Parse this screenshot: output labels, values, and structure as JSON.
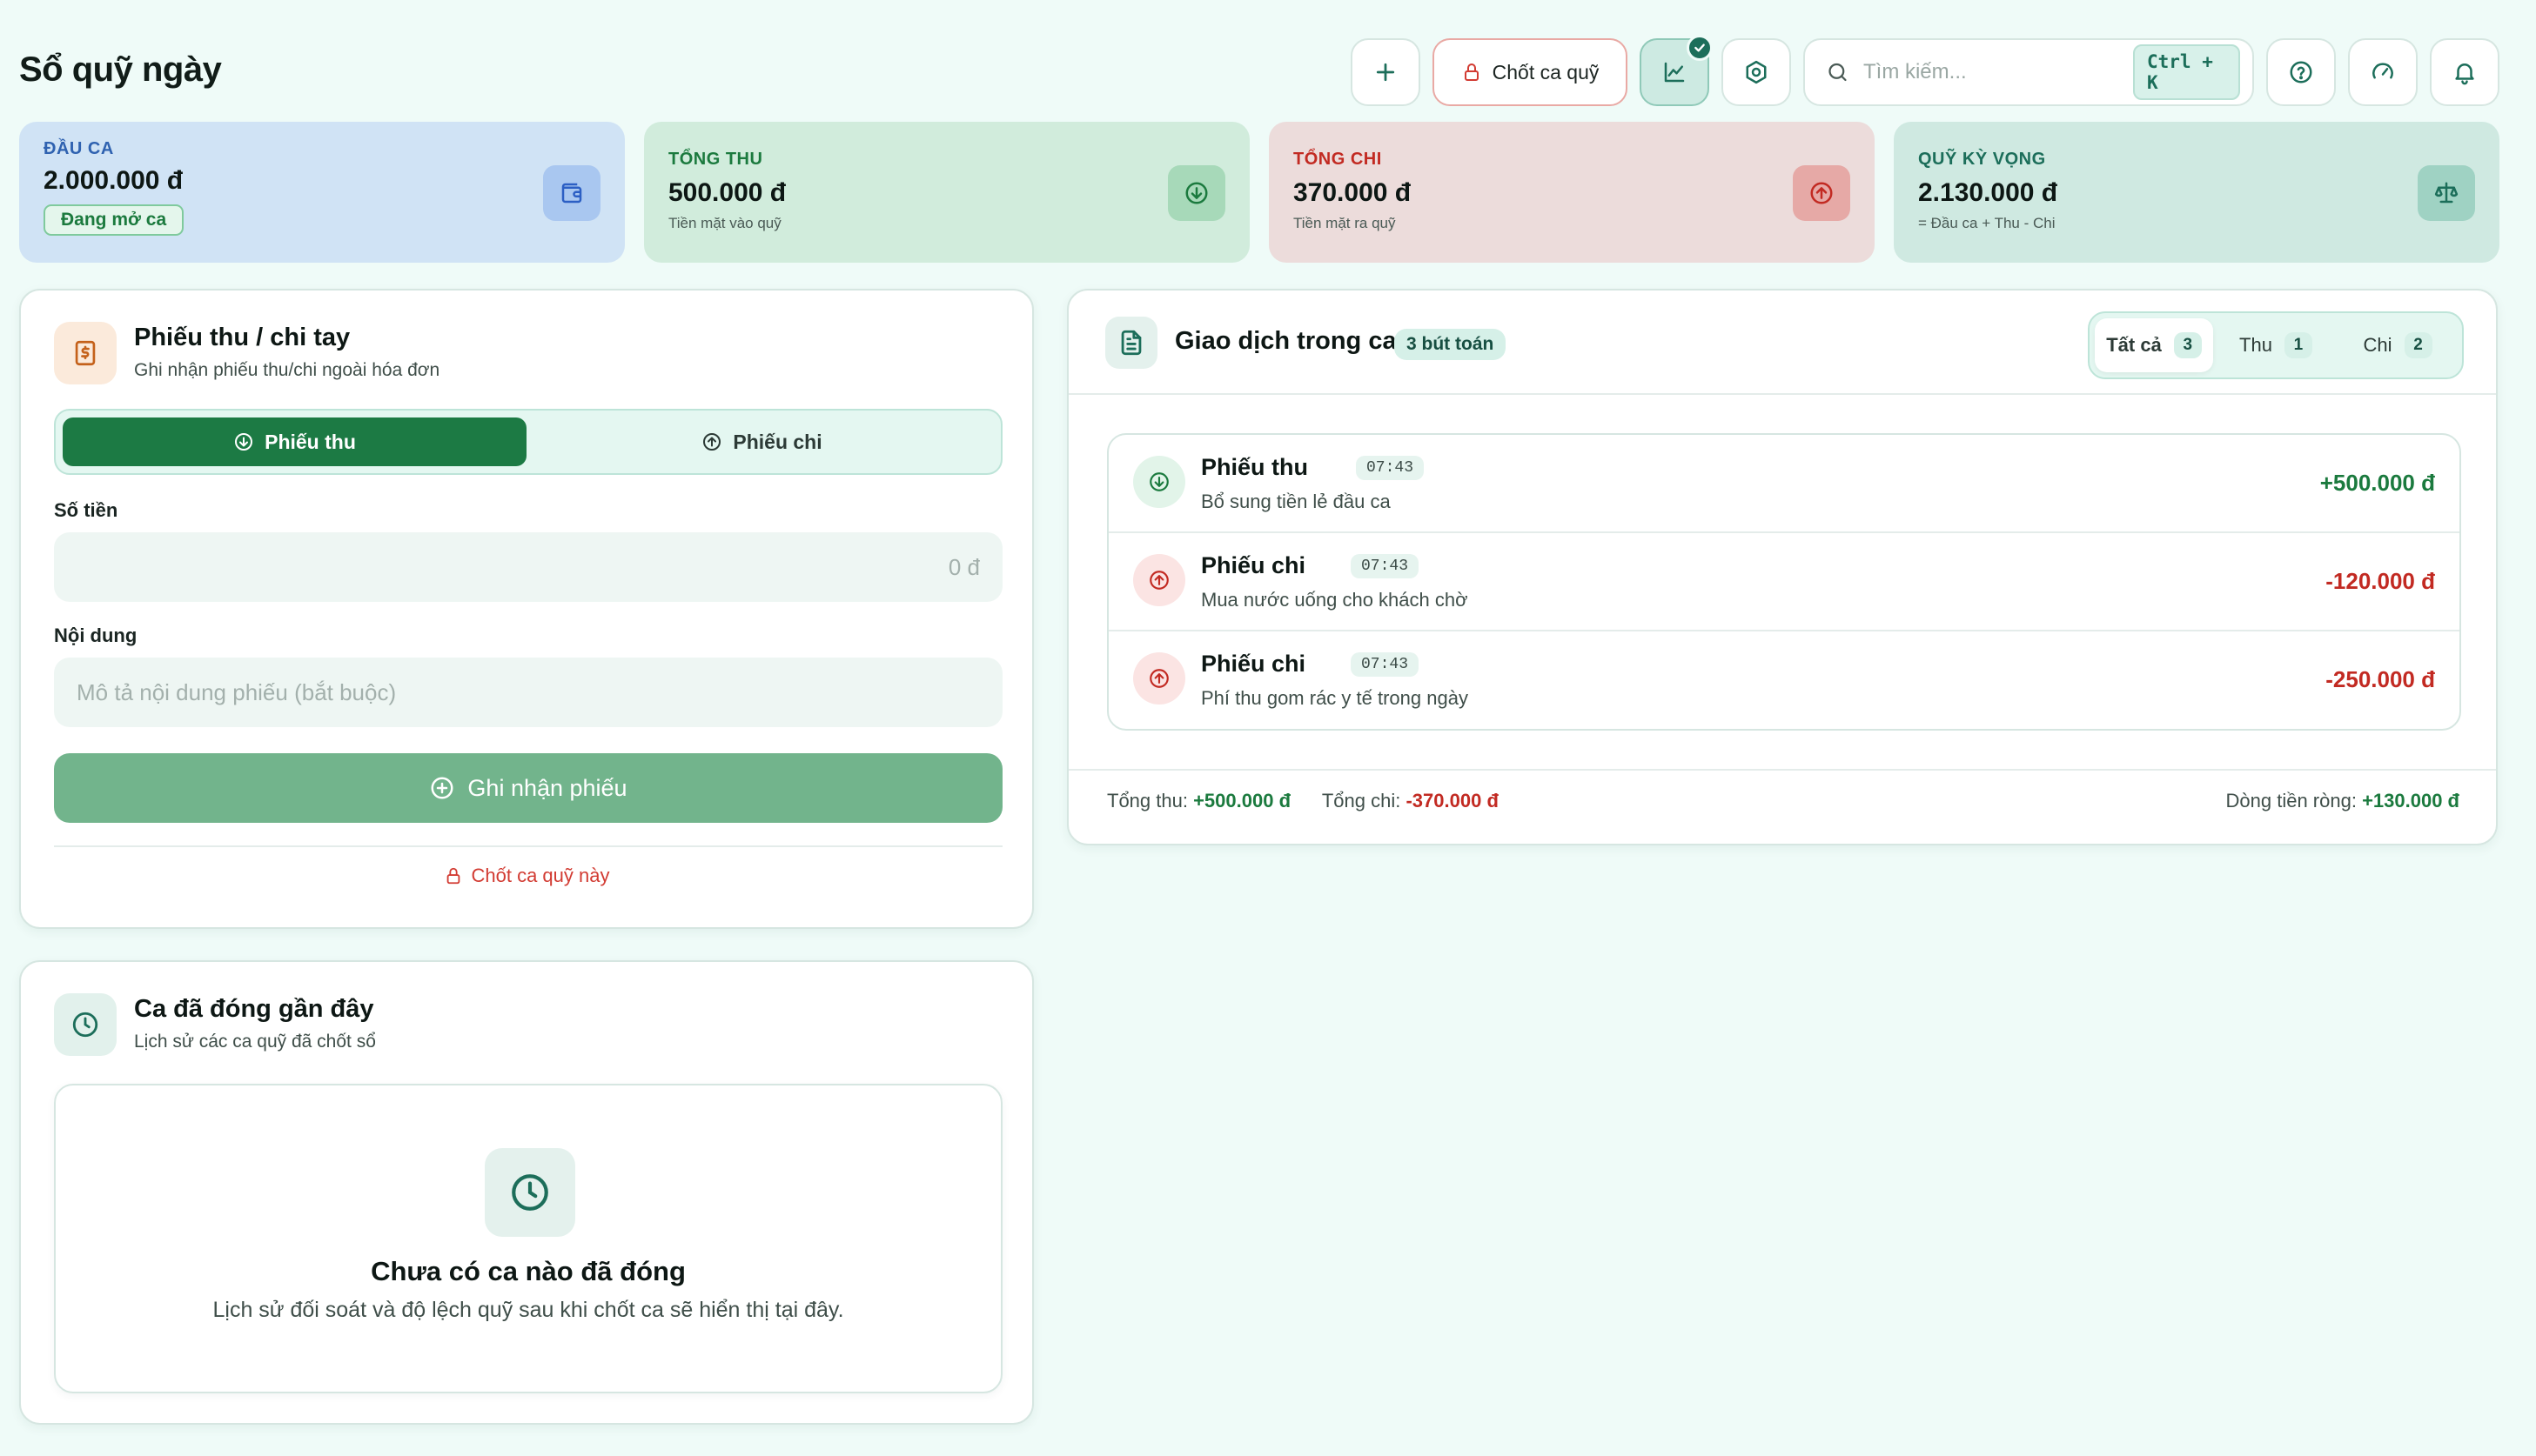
{
  "page": {
    "title": "Sổ quỹ ngày"
  },
  "header": {
    "close_shift_label": "Chốt ca quỹ",
    "search_placeholder": "Tìm kiếm...",
    "search_shortcut": "Ctrl + K"
  },
  "stats": {
    "opening": {
      "label": "Đầu ca",
      "value": "2.000.000 đ",
      "badge": "Đang mở ca"
    },
    "income": {
      "label": "Tổng thu",
      "value": "500.000 đ",
      "sub": "Tiền mặt vào quỹ"
    },
    "expense": {
      "label": "Tổng chi",
      "value": "370.000 đ",
      "sub": "Tiền mặt ra quỹ"
    },
    "expected": {
      "label": "Quỹ kỳ vọng",
      "value": "2.130.000 đ",
      "sub": "= Đầu ca + Thu - Chi"
    }
  },
  "voucher_form": {
    "title": "Phiếu thu / chi tay",
    "subtitle": "Ghi nhận phiếu thu/chi ngoài hóa đơn",
    "tabs": {
      "income": "Phiếu thu",
      "expense": "Phiếu chi"
    },
    "amount_label": "Số tiền",
    "amount_placeholder": "0 đ",
    "content_label": "Nội dung",
    "content_placeholder": "Mô tả nội dung phiếu (bắt buộc)",
    "submit_label": "Ghi nhận phiếu",
    "close_shift_link": "Chốt ca quỹ này"
  },
  "closed_shifts": {
    "title": "Ca đã đóng gần đây",
    "subtitle": "Lịch sử các ca quỹ đã chốt sổ",
    "empty_title": "Chưa có ca nào đã đóng",
    "empty_sub": "Lịch sử đối soát và độ lệch quỹ sau khi chốt ca sẽ hiển thị tại đây."
  },
  "transactions": {
    "title": "Giao dịch trong ca",
    "count_label": "3 bút toán",
    "filters": [
      {
        "label": "Tất cả",
        "count": "3"
      },
      {
        "label": "Thu",
        "count": "1"
      },
      {
        "label": "Chi",
        "count": "2"
      }
    ],
    "items": [
      {
        "type": "Phiếu thu",
        "time": "07:43",
        "desc": "Bổ sung tiền lẻ đầu ca",
        "amount": "+500.000 đ"
      },
      {
        "type": "Phiếu chi",
        "time": "07:43",
        "desc": "Mua nước uống cho khách chờ",
        "amount": "-120.000 đ"
      },
      {
        "type": "Phiếu chi",
        "time": "07:43",
        "desc": "Phí thu gom rác y tế trong ngày",
        "amount": "-250.000 đ"
      }
    ],
    "footer": {
      "income_label": "Tổng thu:",
      "income_value": "+500.000 đ",
      "expense_label": "Tổng chi:",
      "expense_value": "-370.000 đ",
      "net_label": "Dòng tiền ròng:",
      "net_value": "+130.000 đ"
    }
  },
  "colors": {
    "accent": "#1c7a44",
    "teal": "#1c6e5a",
    "income": "#1b7a3e",
    "expense": "#c22a22",
    "background": "#effbf8"
  }
}
